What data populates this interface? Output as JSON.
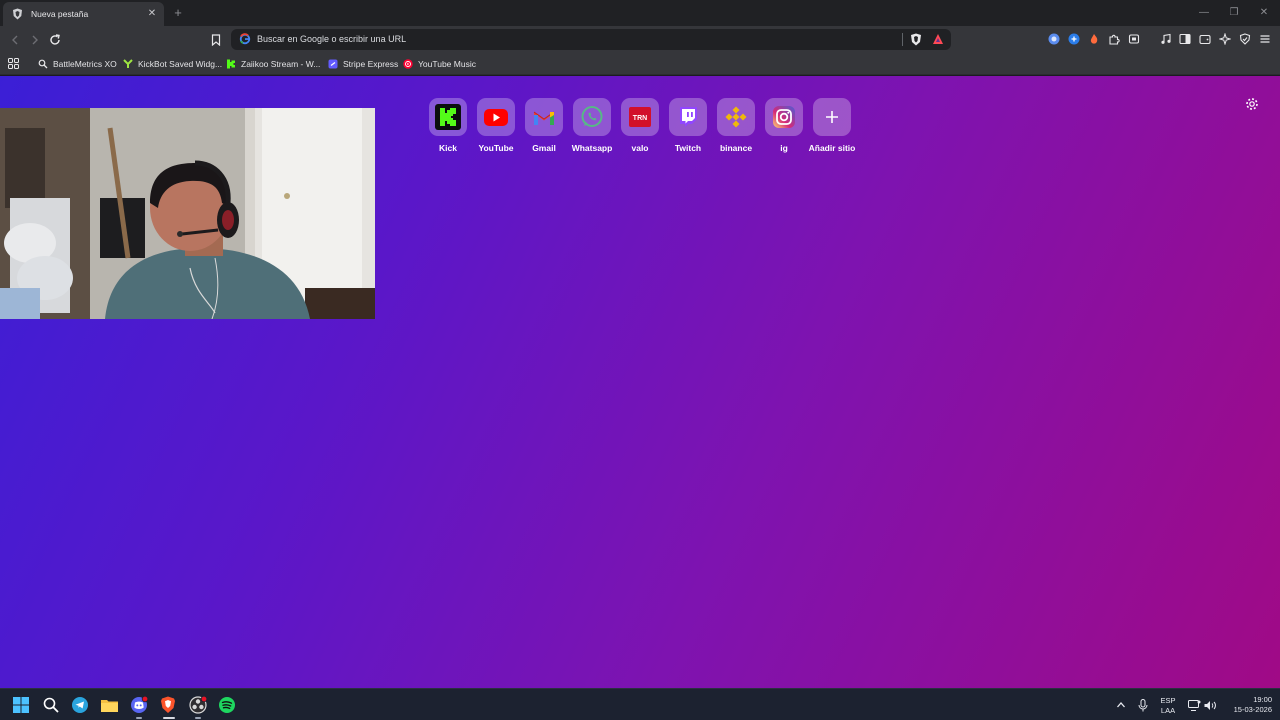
{
  "tabs": [
    {
      "title": "Nueva pestaña"
    }
  ],
  "omnibox": {
    "placeholder": "Buscar en Google o escribir una URL"
  },
  "bookmarks": [
    {
      "label": "BattleMetrics XO",
      "icon": "search-icon"
    },
    {
      "label": "KickBot Saved Widg...",
      "icon": "kickbot-icon"
    },
    {
      "label": "Zaiikoo Stream - W...",
      "icon": "kick-icon"
    },
    {
      "label": "Stripe Express",
      "icon": "stripe-icon"
    },
    {
      "label": "YouTube Music",
      "icon": "youtube-music-icon"
    }
  ],
  "top_sites": [
    {
      "label": "Kick",
      "icon": "kick-icon"
    },
    {
      "label": "YouTube",
      "icon": "youtube-icon"
    },
    {
      "label": "Gmail",
      "icon": "gmail-icon"
    },
    {
      "label": "Whatsapp",
      "icon": "whatsapp-icon"
    },
    {
      "label": "valo",
      "icon": "tracker-network-icon",
      "icon_text": "TRN"
    },
    {
      "label": "Twitch",
      "icon": "twitch-icon"
    },
    {
      "label": "binance",
      "icon": "binance-icon"
    },
    {
      "label": "ig",
      "icon": "instagram-icon"
    },
    {
      "label": "Añadir sitio",
      "icon": "plus-icon"
    }
  ],
  "tray": {
    "lang_top": "ESP",
    "lang_bottom": "LAA",
    "time": "19:00",
    "date": "15-03-2026"
  },
  "colors": {
    "ntp_gradient": [
      "#3b1fd6",
      "#a00a86"
    ],
    "kick_green": "#53fc18",
    "youtube_red": "#ff0000",
    "twitch_purple": "#9146ff",
    "binance_yellow": "#f0b90b"
  }
}
